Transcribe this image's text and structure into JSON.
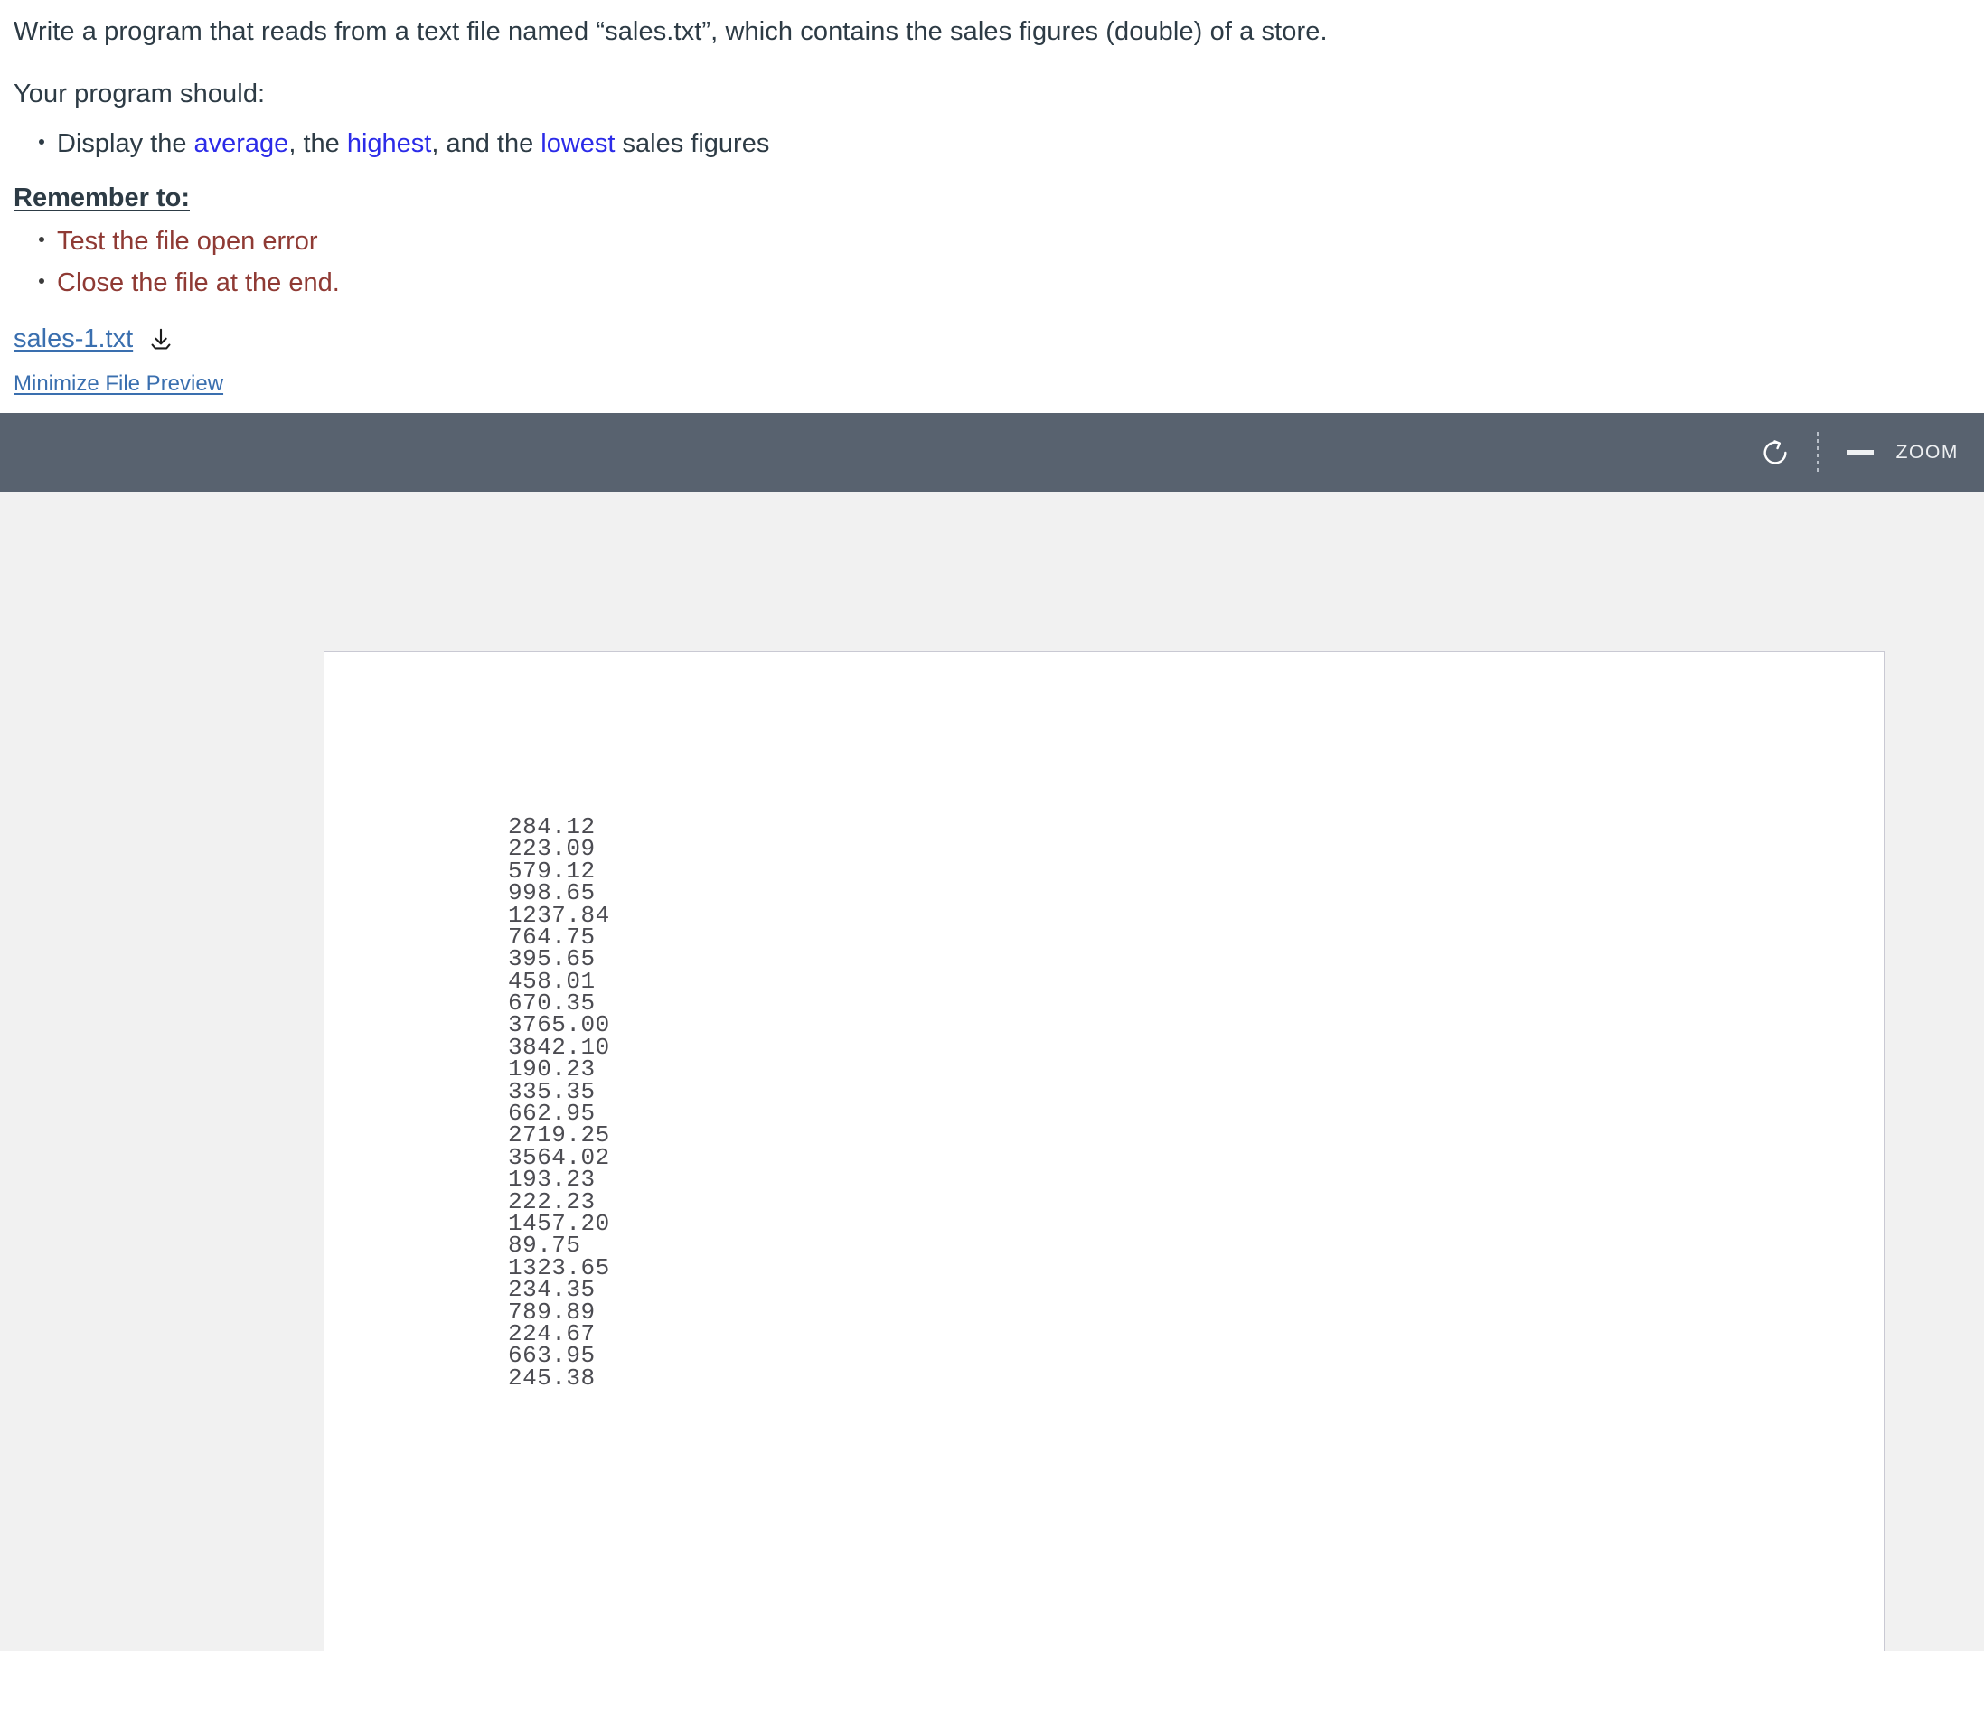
{
  "assignment": {
    "intro": "Write a program that reads from a text file named “sales.txt”, which contains the sales figures (double) of a store.",
    "should_label": "Your program should:",
    "requirements": [
      {
        "pre": "Display the ",
        "kw1": "average",
        "mid1": ", the ",
        "kw2": "highest",
        "mid2": ", and the ",
        "kw3": "lowest",
        "post": " sales figures"
      }
    ],
    "remember_heading": "Remember to:",
    "remember_items": [
      "Test the file open error",
      "Close the file at the end."
    ],
    "attachment": {
      "file_name": "sales-1.txt",
      "download_icon": "download-icon"
    },
    "minimize_link": "Minimize File Preview"
  },
  "preview_toolbar": {
    "rotate_icon": "rotate-icon",
    "zoom_out_icon": "minus-icon",
    "zoom_label": "ZOOM",
    "background_color": "#58626f",
    "icon_color": "#eef0f2"
  },
  "document_preview": {
    "background_color": "#f1f1f1",
    "page_background": "#ffffff",
    "page_border_color": "#c9c9d3",
    "lines": [
      "284.12",
      "223.09",
      "579.12",
      "998.65",
      "1237.84",
      "764.75",
      "395.65",
      "458.01",
      "670.35",
      "3765.00",
      "3842.10",
      "190.23",
      "335.35",
      "662.95",
      "2719.25",
      "3564.02",
      "193.23",
      "222.23",
      "1457.20",
      "89.75",
      "1323.65",
      "234.35",
      "789.89",
      "224.67",
      "663.95",
      "245.38"
    ]
  },
  "colors": {
    "text": "#2d3b45",
    "highlight_blue": "#2b2be8",
    "warning_red": "#8f3a34",
    "link_blue": "#3a6faf"
  }
}
